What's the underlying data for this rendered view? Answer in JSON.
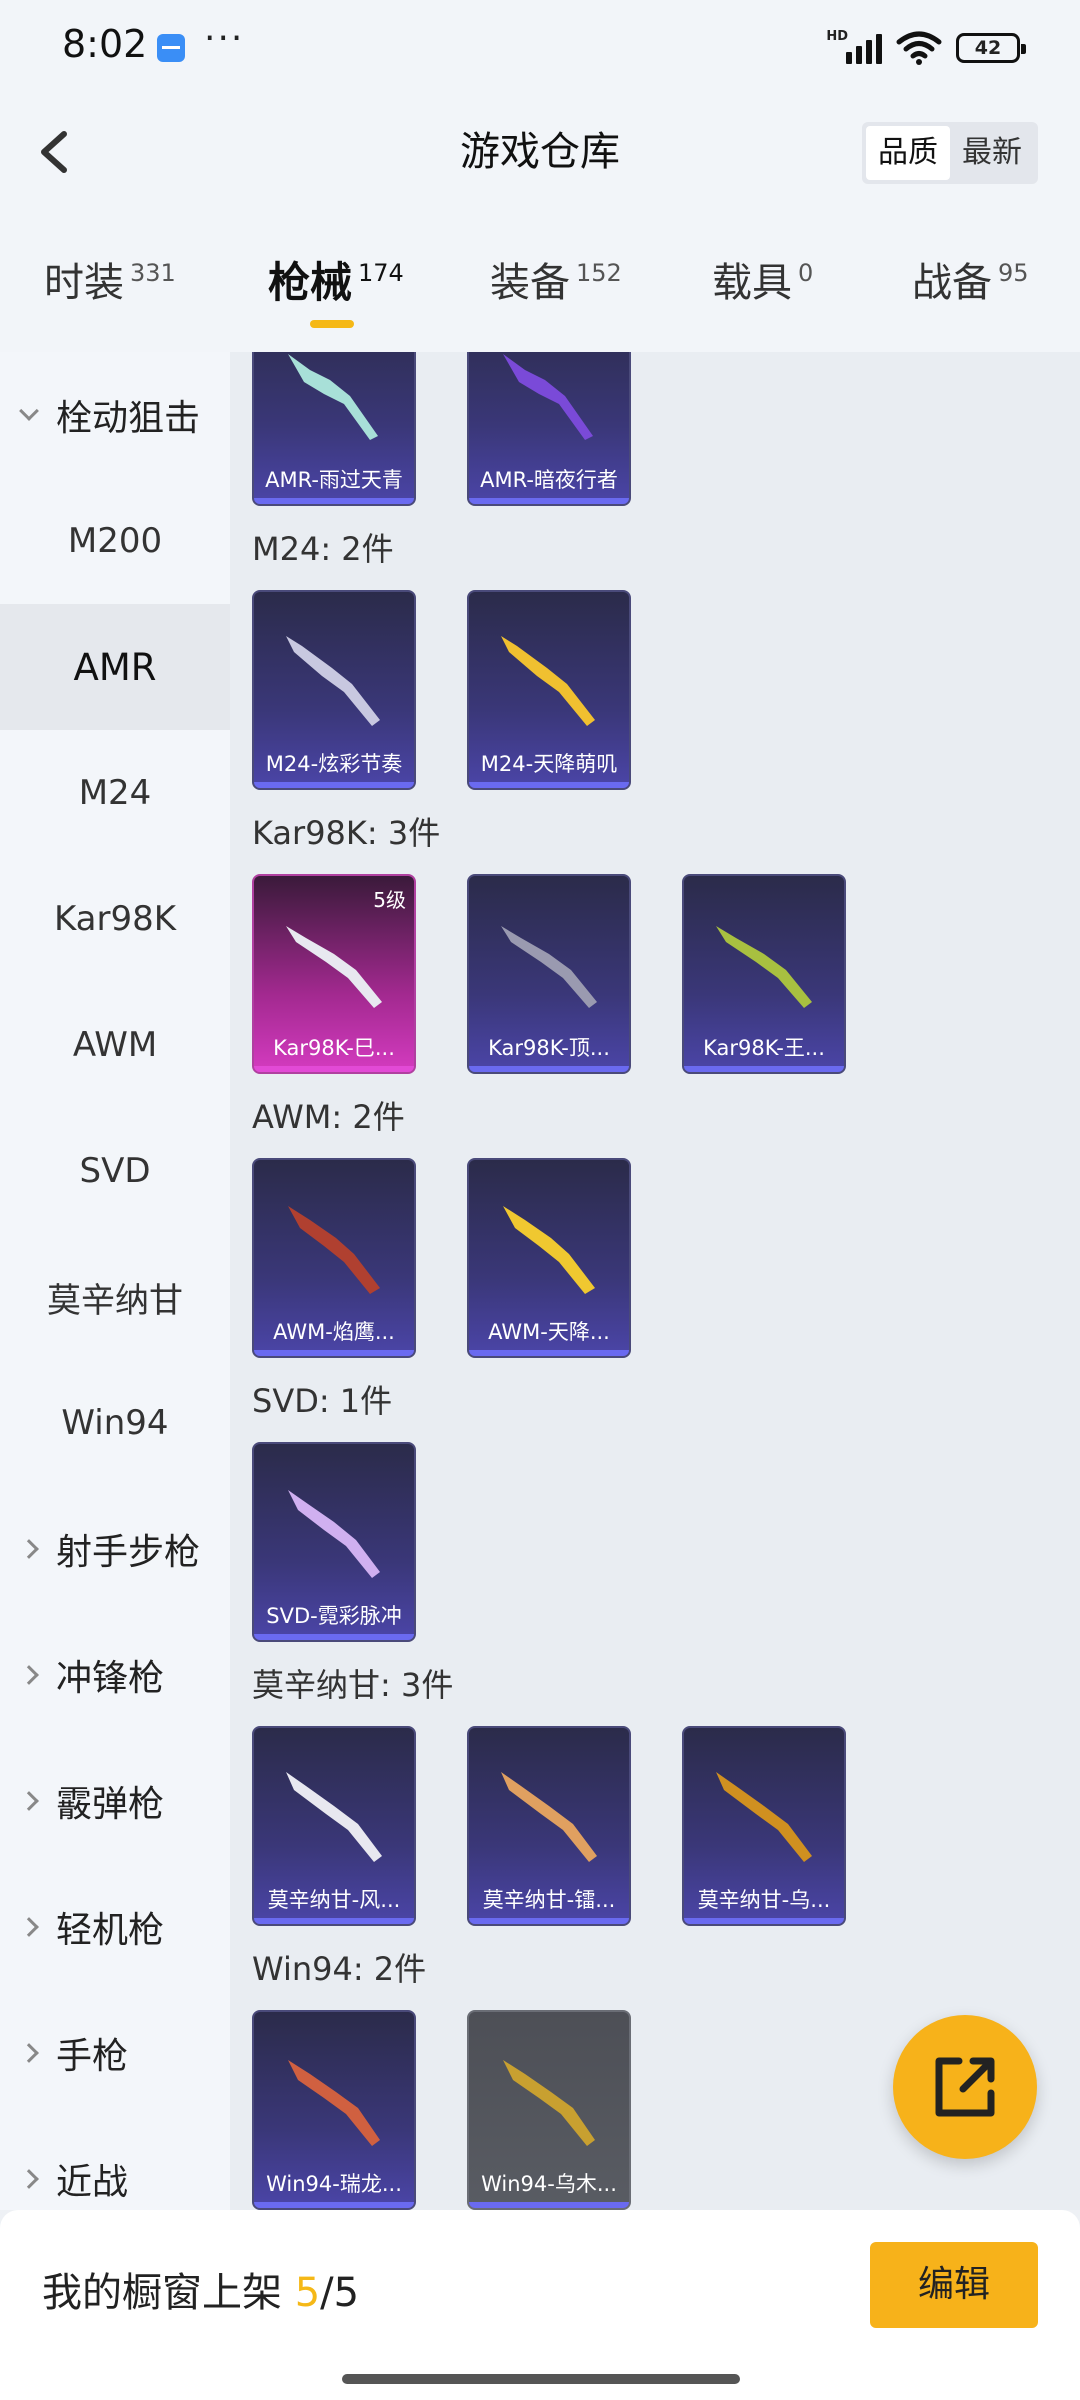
{
  "status_bar": {
    "time": "8:02",
    "hd": "HD",
    "battery": "42"
  },
  "header": {
    "title": "游戏仓库",
    "sort_options": [
      "品质",
      "最新"
    ],
    "sort_active": "品质"
  },
  "tabs": [
    {
      "label": "时装",
      "count": "331"
    },
    {
      "label": "枪械",
      "count": "174"
    },
    {
      "label": "装备",
      "count": "152"
    },
    {
      "label": "载具",
      "count": "0"
    },
    {
      "label": "战备",
      "count": "95"
    }
  ],
  "sidebar": {
    "category_open": "栓动狙击",
    "sub_items": [
      "M200",
      "AMR",
      "M24",
      "Kar98K",
      "AWM",
      "SVD",
      "莫辛纳甘",
      "Win94"
    ],
    "active_item": "AMR",
    "categories": [
      "射手步枪",
      "冲锋枪",
      "霰弹枪",
      "轻机枪",
      "手枪",
      "近战"
    ]
  },
  "content": {
    "groups": [
      {
        "label": "",
        "items": [
          {
            "name": "AMR-雨过天青",
            "style": "purple",
            "gun_color": "#a8e0d8"
          },
          {
            "name": "AMR-暗夜行者",
            "style": "purple",
            "gun_color": "#7a4ad8"
          }
        ]
      },
      {
        "label": "M24: 2件",
        "items": [
          {
            "name": "M24-炫彩节奏",
            "style": "purple",
            "gun_color": "#c8c8e0"
          },
          {
            "name": "M24-天降萌叽",
            "style": "purple",
            "gun_color": "#f0c030"
          }
        ]
      },
      {
        "label": "Kar98K: 3件",
        "items": [
          {
            "name": "Kar98K-巳...",
            "style": "pink",
            "gun_color": "#e8e8f0",
            "level": "5级"
          },
          {
            "name": "Kar98K-顶...",
            "style": "purple",
            "gun_color": "#9a9ab0"
          },
          {
            "name": "Kar98K-王...",
            "style": "purple",
            "gun_color": "#a8c040"
          }
        ]
      },
      {
        "label": "AWM: 2件",
        "items": [
          {
            "name": "AWM-焰鹰...",
            "style": "purple",
            "gun_color": "#b04030"
          },
          {
            "name": "AWM-天降...",
            "style": "purple",
            "gun_color": "#f0c830"
          }
        ]
      },
      {
        "label": "SVD: 1件",
        "items": [
          {
            "name": "SVD-霓彩脉冲",
            "style": "purple",
            "gun_color": "#d0b0f0"
          }
        ]
      },
      {
        "label": "莫辛纳甘: 3件",
        "items": [
          {
            "name": "莫辛纳甘-风...",
            "style": "purple",
            "gun_color": "#e8e8f0"
          },
          {
            "name": "莫辛纳甘-镭...",
            "style": "purple",
            "gun_color": "#e0a060"
          },
          {
            "name": "莫辛纳甘-乌...",
            "style": "purple",
            "gun_color": "#d09020"
          }
        ]
      },
      {
        "label": "Win94: 2件",
        "items": [
          {
            "name": "Win94-瑞龙...",
            "style": "purple",
            "gun_color": "#d06040"
          },
          {
            "name": "Win94-乌木...",
            "style": "gray",
            "gun_color": "#c8a030"
          }
        ]
      }
    ]
  },
  "bottom": {
    "shelf_label": "我的橱窗上架",
    "shelf_used": "5",
    "shelf_total": "/5",
    "edit_label": "编辑"
  },
  "icons": {
    "back": "back-chevron-icon",
    "share": "share-external-icon",
    "wifi": "wifi-icon",
    "signal": "signal-icon",
    "battery": "battery-icon"
  },
  "colors": {
    "accent": "#f7b21a",
    "card_purple": "#3a3778",
    "card_pink": "#d43bc0"
  }
}
